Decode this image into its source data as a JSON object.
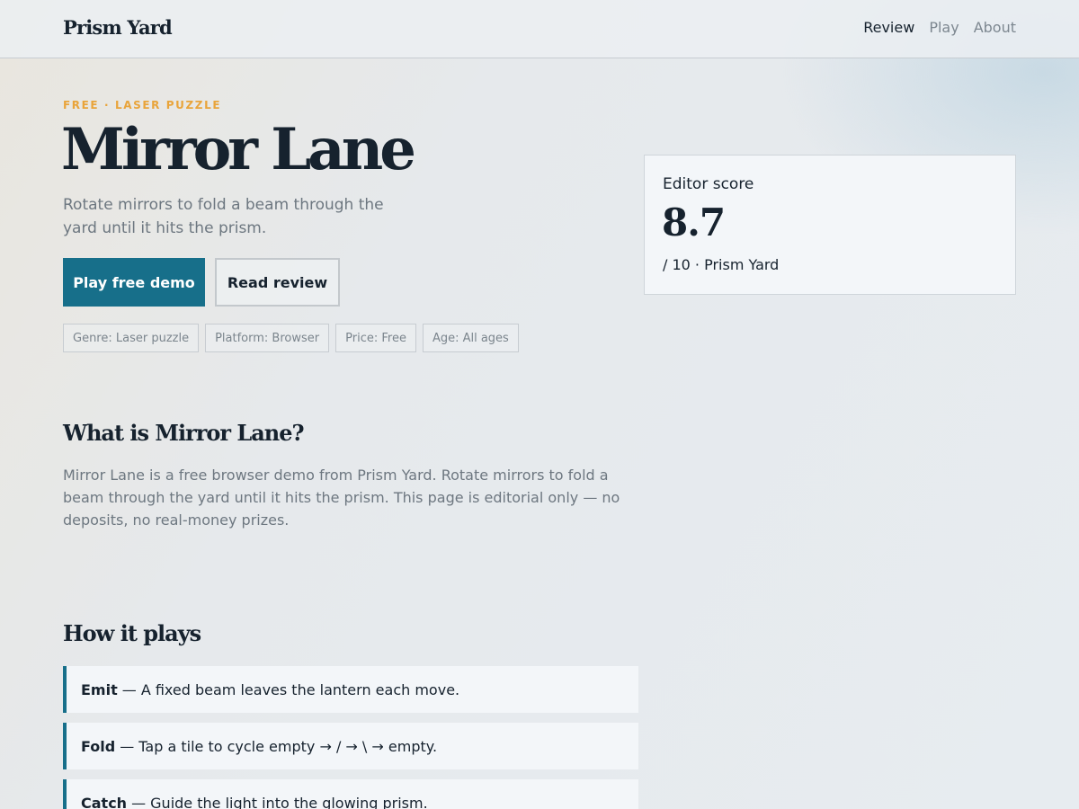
{
  "header": {
    "brand": "Prism Yard",
    "nav": [
      {
        "label": "Review",
        "active": true
      },
      {
        "label": "Play",
        "active": false
      },
      {
        "label": "About",
        "active": false
      }
    ]
  },
  "hero": {
    "eyebrow": "FREE · LASER PUZZLE",
    "title": "Mirror Lane",
    "subtitle": "Rotate mirrors to fold a beam through the yard until it hits the prism.",
    "primary_button": "Play free demo",
    "secondary_button": "Read review",
    "tags": [
      "Genre: Laser puzzle",
      "Platform: Browser",
      "Price: Free",
      "Age: All ages"
    ]
  },
  "score": {
    "label": "Editor score",
    "value": "8.7",
    "sub": "/ 10 · Prism Yard"
  },
  "about": {
    "title": "What is Mirror Lane?",
    "body": "Mirror Lane is a free browser demo from Prism Yard. Rotate mirrors to fold a beam through the yard until it hits the prism. This page is editorial only — no deposits, no real-money prizes."
  },
  "plays": {
    "title": "How it plays",
    "steps": [
      {
        "name": "Emit",
        "text": "— A fixed beam leaves the lantern each move."
      },
      {
        "name": "Fold",
        "text": "— Tap a tile to cycle empty → / → \\ → empty."
      },
      {
        "name": "Catch",
        "text": "— Guide the light into the glowing prism."
      }
    ]
  },
  "colors": {
    "accent": "#176f8a",
    "eyebrow": "#e9a43a",
    "text": "#16222e",
    "muted": "#6d7780"
  }
}
